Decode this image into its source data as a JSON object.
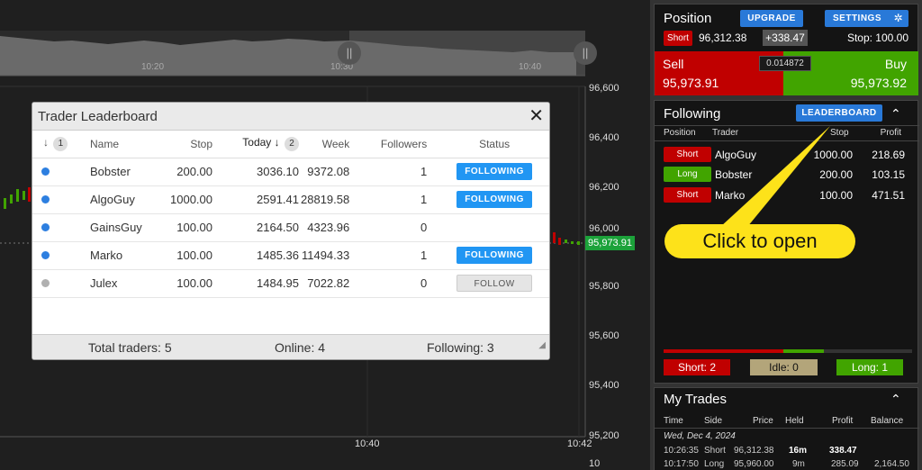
{
  "chart": {
    "price_levels": [
      "96,600",
      "96,400",
      "96,200",
      "96,000",
      "95,800",
      "95,600",
      "95,400",
      "95,200"
    ],
    "current_price": "95,973.91",
    "volume_label": "10",
    "time_labels": [
      "10:40",
      "10:42"
    ],
    "navigator_times": [
      "10:20",
      "10:30",
      "10:40"
    ],
    "navigator_handle": "||"
  },
  "leaderboard": {
    "title": "Trader Leaderboard",
    "close_icon": "✕",
    "columns": {
      "rank_arrow": "↓",
      "rank_badge": "1",
      "name": "Name",
      "stop": "Stop",
      "today": "Today",
      "today_arrow": "↓",
      "today_badge": "2",
      "week": "Week",
      "followers": "Followers",
      "status": "Status"
    },
    "rows": [
      {
        "online": true,
        "name": "Bobster",
        "stop": "200.00",
        "today": "3036.10",
        "week": "9372.08",
        "followers": "1",
        "status": "FOLLOWING"
      },
      {
        "online": true,
        "name": "AlgoGuy",
        "stop": "1000.00",
        "today": "2591.41",
        "week": "28819.58",
        "followers": "1",
        "status": "FOLLOWING"
      },
      {
        "online": true,
        "name": "GainsGuy",
        "stop": "100.00",
        "today": "2164.50",
        "week": "4323.96",
        "followers": "0",
        "status": ""
      },
      {
        "online": true,
        "name": "Marko",
        "stop": "100.00",
        "today": "1485.36",
        "week": "11494.33",
        "followers": "1",
        "status": "FOLLOWING"
      },
      {
        "online": false,
        "name": "Julex",
        "stop": "100.00",
        "today": "1484.95",
        "week": "7022.82",
        "followers": "0",
        "status": "FOLLOW"
      }
    ],
    "footer": {
      "total": "Total traders: 5",
      "online": "Online: 4",
      "following": "Following: 3"
    },
    "colors": {
      "online_dot": "#2d7fe0",
      "offline_dot": "#b0b0b0",
      "following_btn": "#2196f3"
    }
  },
  "position": {
    "title": "Position",
    "upgrade": "UPGRADE",
    "settings": "SETTINGS",
    "settings_icon": "✲",
    "side": "Short",
    "entry": "96,312.38",
    "pnl": "+338.47",
    "stop_label": "Stop: 100.00",
    "sell_label": "Sell",
    "sell_price": "95,973.91",
    "buy_label": "Buy",
    "buy_price": "95,973.92",
    "spread": "0.014872",
    "colors": {
      "sell": "#c00000",
      "buy": "#41a400"
    }
  },
  "following": {
    "title": "Following",
    "leaderboard_btn": "LEADERBOARD",
    "chevron": "⌃",
    "columns": {
      "position": "Position",
      "trader": "Trader",
      "stop": "Stop",
      "profit": "Profit"
    },
    "rows": [
      {
        "side": "Short",
        "trader": "AlgoGuy",
        "stop": "1000.00",
        "profit": "218.69"
      },
      {
        "side": "Long",
        "trader": "Bobster",
        "stop": "200.00",
        "profit": "103.15"
      },
      {
        "side": "Short",
        "trader": "Marko",
        "stop": "100.00",
        "profit": "471.51"
      }
    ],
    "sentiment": {
      "short": "Short: 2",
      "idle": "Idle: 0",
      "long": "Long: 1"
    }
  },
  "callout": {
    "text": "Click to open"
  },
  "my_trades": {
    "title": "My Trades",
    "chevron": "⌃",
    "columns": {
      "time": "Time",
      "side": "Side",
      "price": "Price",
      "held": "Held",
      "profit": "Profit",
      "balance": "Balance"
    },
    "date": "Wed, Dec 4, 2024",
    "rows": [
      {
        "time": "10:26:35",
        "side": "Short",
        "price": "96,312.38",
        "held": "16m",
        "profit": "338.47",
        "balance": ""
      },
      {
        "time": "10:17:50",
        "side": "Long",
        "price": "95,960.00",
        "held": "9m",
        "profit": "285.09",
        "balance": "2,164.50"
      }
    ]
  }
}
